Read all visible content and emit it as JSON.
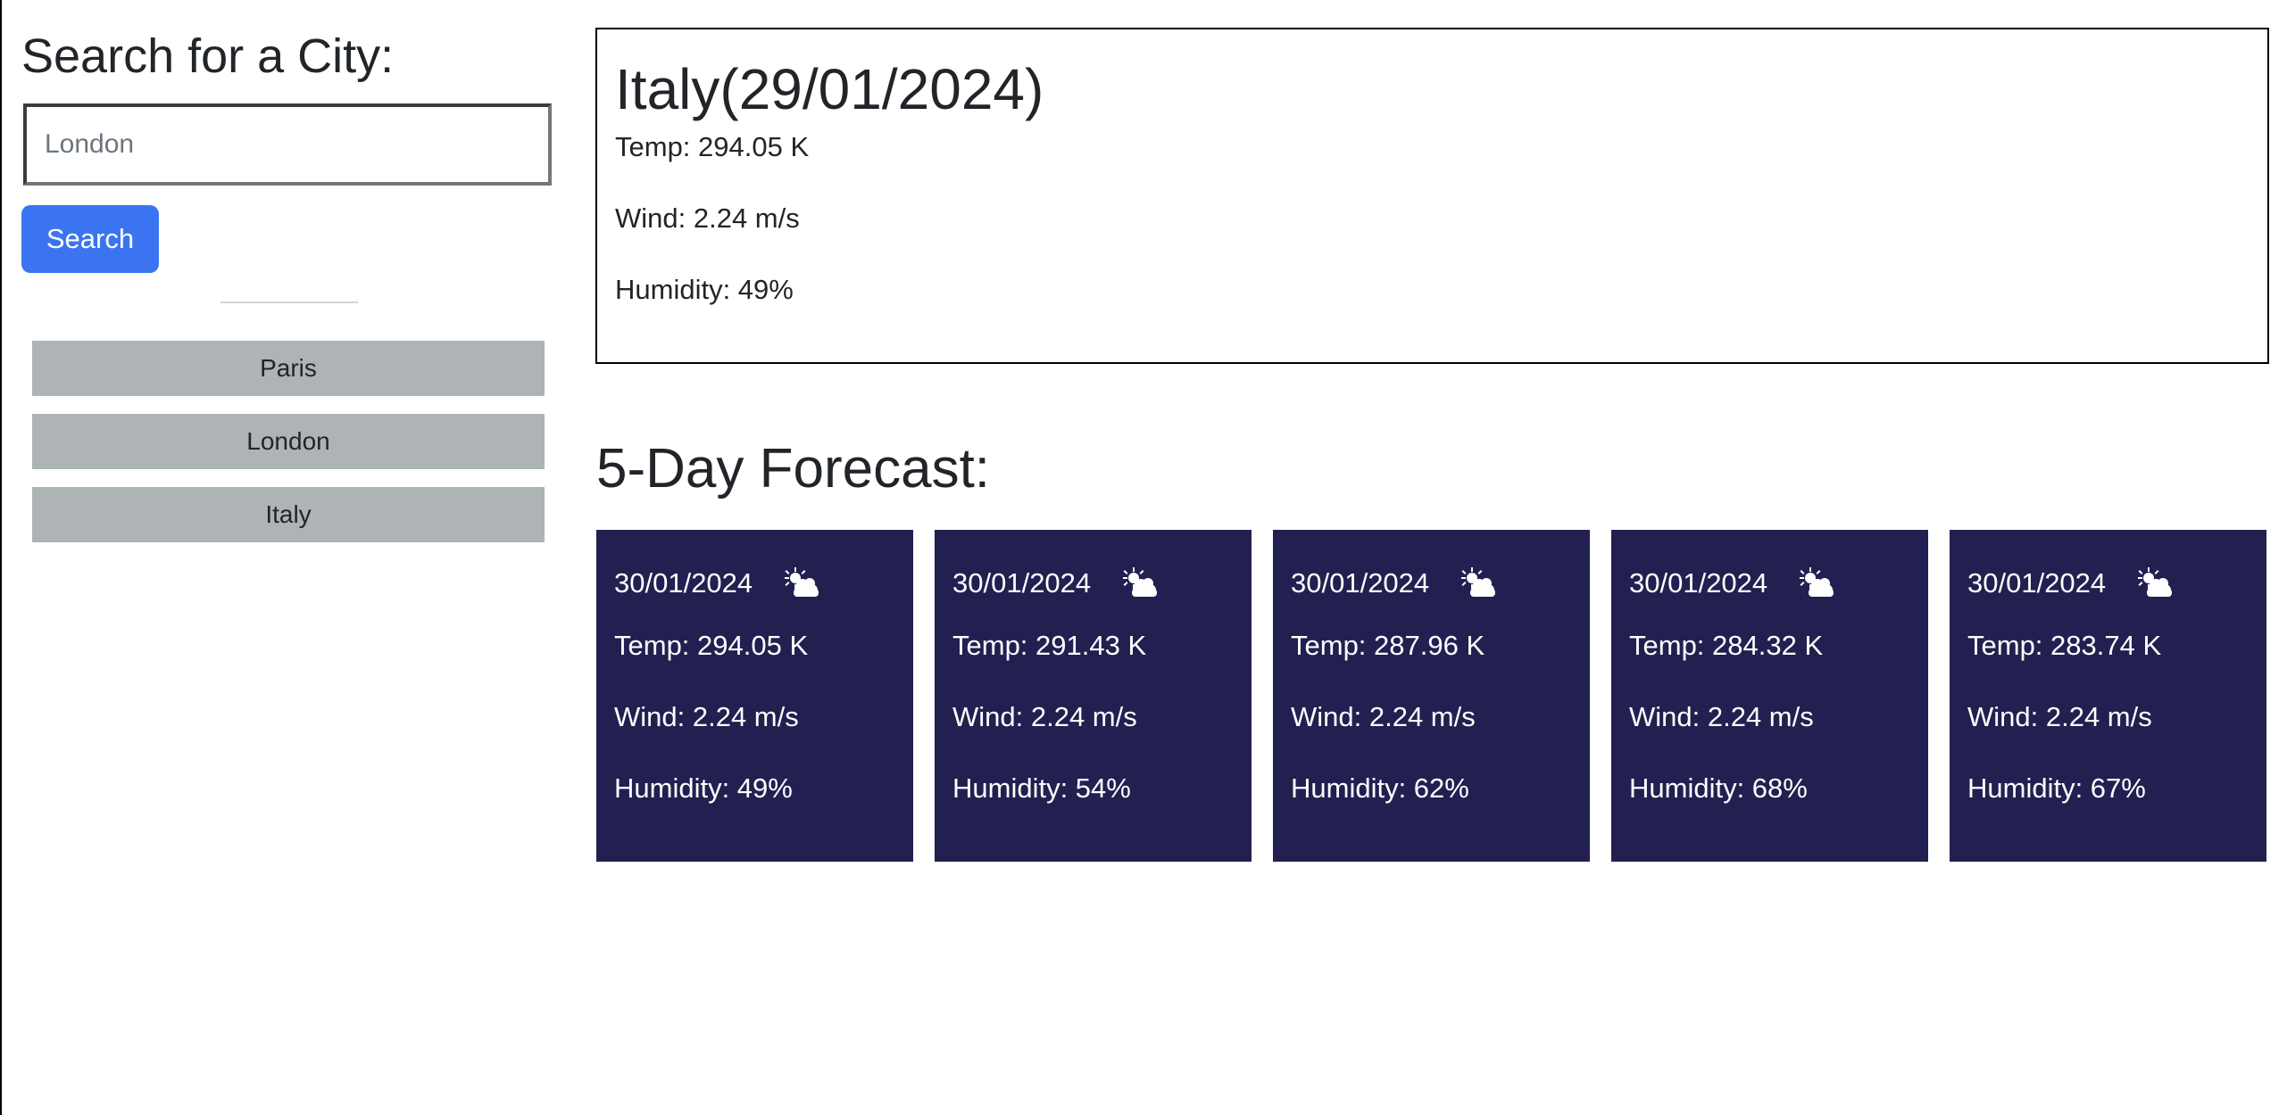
{
  "sidebar": {
    "title": "Search for a City:",
    "search_placeholder": "London",
    "search_button_label": "Search",
    "history": [
      "Paris",
      "London",
      "Italy"
    ]
  },
  "current": {
    "title": "Italy(29/01/2024)",
    "temp": "Temp: 294.05 K",
    "wind": "Wind: 2.24 m/s",
    "humidity": "Humidity: 49%"
  },
  "forecast": {
    "heading": "5-Day Forecast:",
    "cards": [
      {
        "date": "30/01/2024",
        "icon": "partly-cloudy-icon",
        "temp": "Temp: 294.05 K",
        "wind": "Wind: 2.24 m/s",
        "humidity": "Humidity: 49%"
      },
      {
        "date": "30/01/2024",
        "icon": "partly-cloudy-icon",
        "temp": "Temp: 291.43 K",
        "wind": "Wind: 2.24 m/s",
        "humidity": "Humidity: 54%"
      },
      {
        "date": "30/01/2024",
        "icon": "partly-cloudy-icon",
        "temp": "Temp: 287.96 K",
        "wind": "Wind: 2.24 m/s",
        "humidity": "Humidity: 62%"
      },
      {
        "date": "30/01/2024",
        "icon": "partly-cloudy-icon",
        "temp": "Temp: 284.32 K",
        "wind": "Wind: 2.24 m/s",
        "humidity": "Humidity: 68%"
      },
      {
        "date": "30/01/2024",
        "icon": "partly-cloudy-icon",
        "temp": "Temp: 283.74 K",
        "wind": "Wind: 2.24 m/s",
        "humidity": "Humidity: 67%"
      }
    ]
  },
  "colors": {
    "search_button": "#3b74f0",
    "history_button": "#aeb3b5",
    "forecast_card": "#222050",
    "text": "#212529"
  }
}
